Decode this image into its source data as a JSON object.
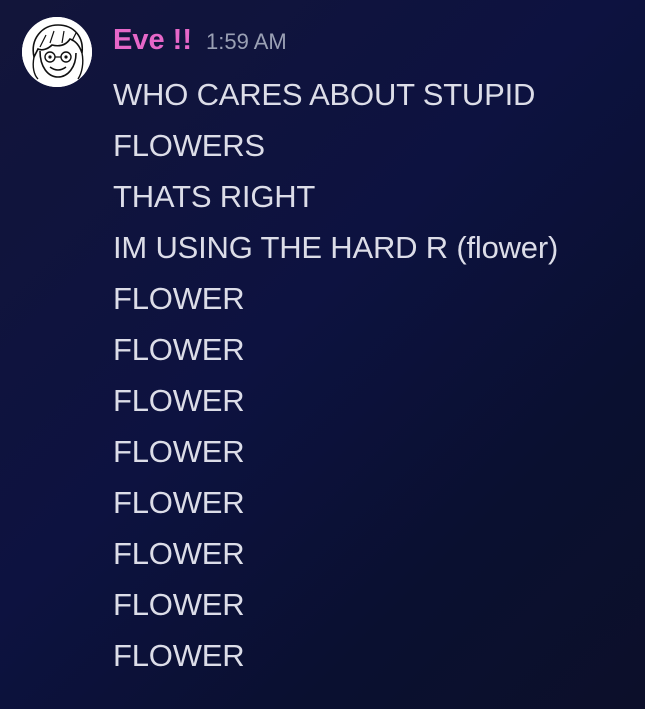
{
  "message": {
    "author": "Eve !!",
    "timestamp": "1:59 AM",
    "author_color": "#e667c8",
    "avatar_icon": "user-avatar-drawing",
    "lines": [
      "WHO CARES ABOUT STUPID",
      "FLOWERS",
      "THATS RIGHT",
      "IM USING THE HARD R (flower)",
      "FLOWER",
      "FLOWER",
      "FLOWER",
      "FLOWER",
      "FLOWER",
      "FLOWER",
      "FLOWER",
      "FLOWER"
    ]
  }
}
